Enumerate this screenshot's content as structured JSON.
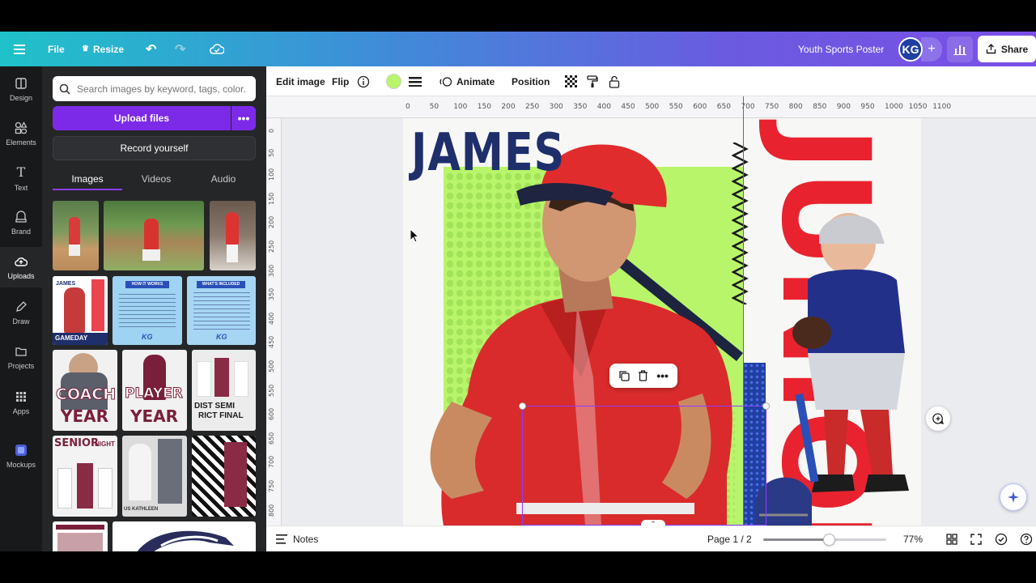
{
  "topbar": {
    "file_label": "File",
    "resize_label": "Resize",
    "doc_title": "Youth Sports Poster",
    "avatar_initials": "KG",
    "share_label": "Share"
  },
  "rail": {
    "items": [
      {
        "label": "Design",
        "icon": "design-icon"
      },
      {
        "label": "Elements",
        "icon": "elements-icon"
      },
      {
        "label": "Text",
        "icon": "text-icon"
      },
      {
        "label": "Brand",
        "icon": "brand-icon"
      },
      {
        "label": "Uploads",
        "icon": "uploads-icon"
      },
      {
        "label": "Draw",
        "icon": "draw-icon"
      },
      {
        "label": "Projects",
        "icon": "projects-icon"
      },
      {
        "label": "Apps",
        "icon": "apps-icon"
      },
      {
        "label": "Mockups",
        "icon": "mockups-icon"
      }
    ],
    "active": "Uploads"
  },
  "panel": {
    "search_placeholder": "Search images by keyword, tags, color...",
    "upload_label": "Upload files",
    "record_label": "Record yourself",
    "tabs": [
      "Images",
      "Videos",
      "Audio"
    ],
    "active_tab": "Images",
    "thumb_texts": {
      "gameday_name": "JAMES",
      "gameday_label": "GAMEDAY",
      "how_title": "HOW IT WORKS",
      "included_title": "WHAT'S INCLUDED",
      "coach_title": "COACH",
      "coach_year": "YEAR",
      "player_title": "PLAYER",
      "player_year": "YEAR",
      "district_title": "DIST SEMI",
      "district_sub": "RICT FINAL",
      "senior_title": "SENIOR",
      "senior_night": "NIGHT",
      "kathleen": "US KATHLEEN"
    }
  },
  "editbar": {
    "edit_image": "Edit image",
    "flip": "Flip",
    "animate": "Animate",
    "position": "Position",
    "fill_color": "#b8f56b"
  },
  "ruler": {
    "h_ticks": [
      "0",
      "50",
      "100",
      "150",
      "200",
      "250",
      "300",
      "350",
      "400",
      "450",
      "500",
      "550",
      "600",
      "650",
      "700",
      "750",
      "800",
      "850",
      "900",
      "950",
      "1000",
      "1050",
      "1100"
    ],
    "v_ticks": [
      "0",
      "50",
      "100",
      "150",
      "200",
      "250",
      "300",
      "350",
      "400",
      "450",
      "500",
      "550",
      "600",
      "650",
      "700",
      "750",
      "800"
    ]
  },
  "canvas": {
    "name_text": "JAMES",
    "vertical_text": "JUNIOR",
    "colors": {
      "green": "#b8f56b",
      "navy": "#1f2f6b",
      "red": "#e8232f"
    }
  },
  "bottombar": {
    "notes_label": "Notes",
    "page_indicator": "Page 1 / 2",
    "zoom": "77%",
    "zoom_fraction": 0.53
  }
}
